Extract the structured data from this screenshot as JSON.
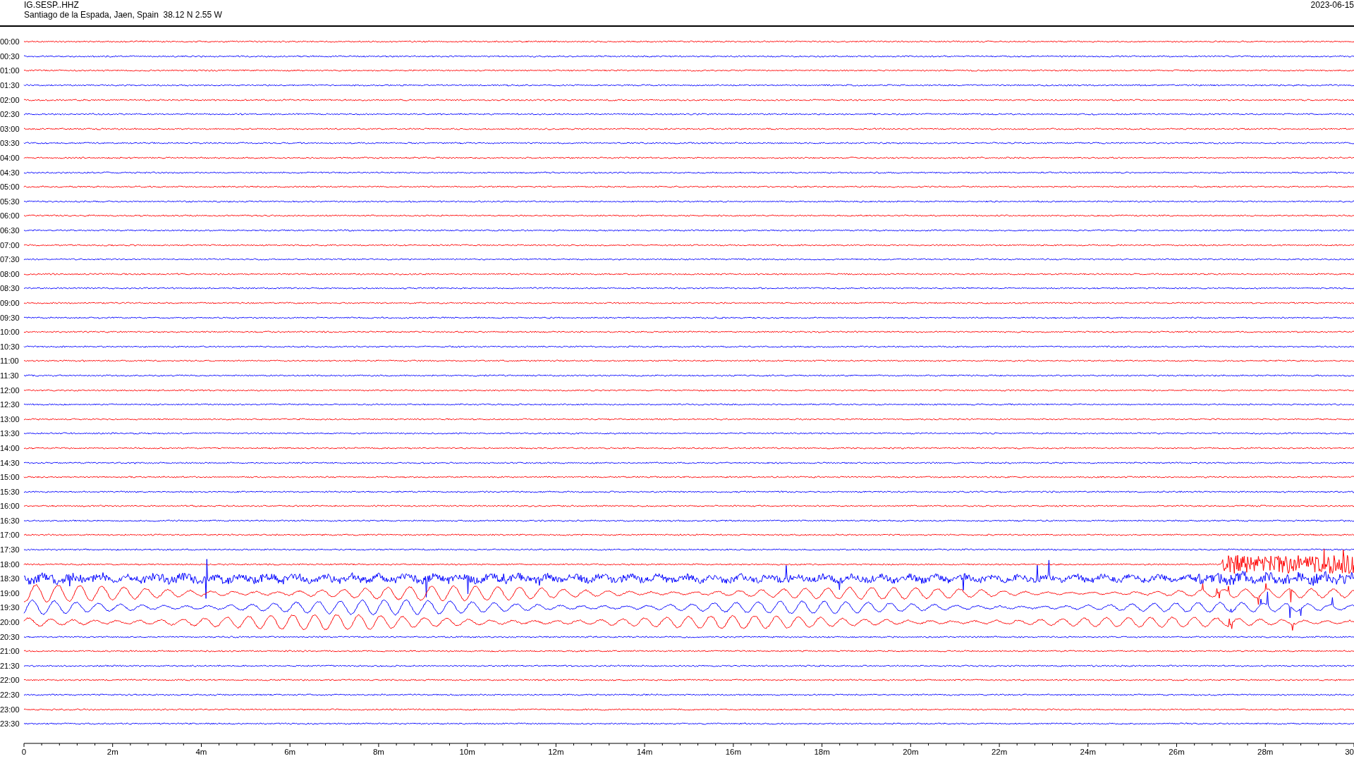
{
  "header": {
    "station": "IG.SESP..HHZ",
    "location": "Santiago de la Espada, Jaen, Spain  38.12 N 2.55 W",
    "date": "2023-06-15"
  },
  "traces": [
    {
      "time": "00:00",
      "color": "#ff0000",
      "kind": "quiet"
    },
    {
      "time": "00:30",
      "color": "#0000ff",
      "kind": "quiet"
    },
    {
      "time": "01:00",
      "color": "#ff0000",
      "kind": "quiet"
    },
    {
      "time": "01:30",
      "color": "#0000ff",
      "kind": "quiet"
    },
    {
      "time": "02:00",
      "color": "#ff0000",
      "kind": "quiet"
    },
    {
      "time": "02:30",
      "color": "#0000ff",
      "kind": "quiet"
    },
    {
      "time": "03:00",
      "color": "#ff0000",
      "kind": "quiet"
    },
    {
      "time": "03:30",
      "color": "#0000ff",
      "kind": "quiet"
    },
    {
      "time": "04:00",
      "color": "#ff0000",
      "kind": "quiet"
    },
    {
      "time": "04:30",
      "color": "#0000ff",
      "kind": "quiet"
    },
    {
      "time": "05:00",
      "color": "#ff0000",
      "kind": "quiet"
    },
    {
      "time": "05:30",
      "color": "#0000ff",
      "kind": "quiet"
    },
    {
      "time": "06:00",
      "color": "#ff0000",
      "kind": "quiet"
    },
    {
      "time": "06:30",
      "color": "#0000ff",
      "kind": "quiet"
    },
    {
      "time": "07:00",
      "color": "#ff0000",
      "kind": "quiet"
    },
    {
      "time": "07:30",
      "color": "#0000ff",
      "kind": "quiet"
    },
    {
      "time": "08:00",
      "color": "#ff0000",
      "kind": "quiet"
    },
    {
      "time": "08:30",
      "color": "#0000ff",
      "kind": "quiet"
    },
    {
      "time": "09:00",
      "color": "#ff0000",
      "kind": "quiet"
    },
    {
      "time": "09:30",
      "color": "#0000ff",
      "kind": "quiet"
    },
    {
      "time": "10:00",
      "color": "#ff0000",
      "kind": "quiet"
    },
    {
      "time": "10:30",
      "color": "#0000ff",
      "kind": "quiet"
    },
    {
      "time": "11:00",
      "color": "#ff0000",
      "kind": "quiet"
    },
    {
      "time": "11:30",
      "color": "#0000ff",
      "kind": "quiet"
    },
    {
      "time": "12:00",
      "color": "#ff0000",
      "kind": "quiet"
    },
    {
      "time": "12:30",
      "color": "#0000ff",
      "kind": "quiet"
    },
    {
      "time": "13:00",
      "color": "#ff0000",
      "kind": "quiet"
    },
    {
      "time": "13:30",
      "color": "#0000ff",
      "kind": "quiet"
    },
    {
      "time": "14:00",
      "color": "#ff0000",
      "kind": "quiet"
    },
    {
      "time": "14:30",
      "color": "#0000ff",
      "kind": "quiet"
    },
    {
      "time": "15:00",
      "color": "#ff0000",
      "kind": "quiet"
    },
    {
      "time": "15:30",
      "color": "#0000ff",
      "kind": "quiet"
    },
    {
      "time": "16:00",
      "color": "#ff0000",
      "kind": "quiet"
    },
    {
      "time": "16:30",
      "color": "#0000ff",
      "kind": "quiet"
    },
    {
      "time": "17:00",
      "color": "#ff0000",
      "kind": "quiet"
    },
    {
      "time": "17:30",
      "color": "#0000ff",
      "kind": "quiet"
    },
    {
      "time": "18:00",
      "color": "#ff0000",
      "kind": "onset"
    },
    {
      "time": "18:30",
      "color": "#0000ff",
      "kind": "spiky"
    },
    {
      "time": "19:00",
      "color": "#ff0000",
      "kind": "wave"
    },
    {
      "time": "19:30",
      "color": "#0000ff",
      "kind": "wave"
    },
    {
      "time": "20:00",
      "color": "#ff0000",
      "kind": "wave"
    },
    {
      "time": "20:30",
      "color": "#0000ff",
      "kind": "quiet"
    },
    {
      "time": "21:00",
      "color": "#ff0000",
      "kind": "quiet"
    },
    {
      "time": "21:30",
      "color": "#0000ff",
      "kind": "quiet"
    },
    {
      "time": "22:00",
      "color": "#ff0000",
      "kind": "quiet"
    },
    {
      "time": "22:30",
      "color": "#0000ff",
      "kind": "quiet"
    },
    {
      "time": "23:00",
      "color": "#ff0000",
      "kind": "quiet"
    },
    {
      "time": "23:30",
      "color": "#0000ff",
      "kind": "quiet"
    }
  ],
  "axis": {
    "labels": [
      "0",
      "2m",
      "4m",
      "6m",
      "8m",
      "10m",
      "12m",
      "14m",
      "16m",
      "18m",
      "20m",
      "22m",
      "24m",
      "26m",
      "28m",
      "30"
    ]
  }
}
